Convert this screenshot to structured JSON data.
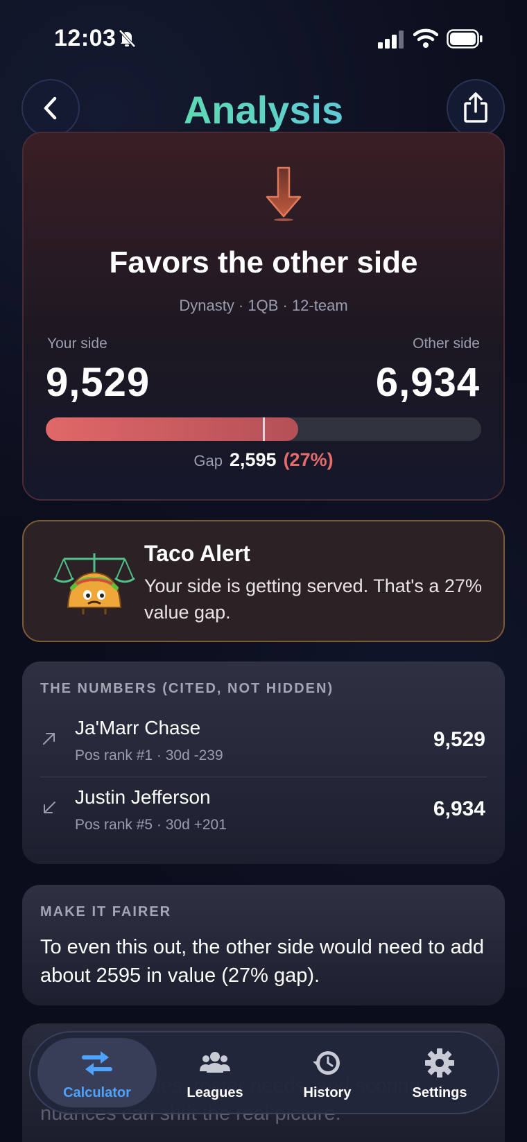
{
  "status_bar": {
    "time": "12:03"
  },
  "header": {
    "title": "Analysis"
  },
  "verdict": {
    "title": "Favors the other side",
    "subtitle": "Dynasty · 1QB · 12-team",
    "your_side_label": "Your side",
    "your_side_value": "9,529",
    "other_side_label": "Other side",
    "other_side_value": "6,934",
    "bar_fill_fraction": 0.58,
    "gap_label": "Gap",
    "gap_value": "2,595",
    "gap_percent": "(27%)"
  },
  "alert": {
    "title": "Taco Alert",
    "text": "Your side is getting served. That's a 27% value gap."
  },
  "numbers": {
    "heading": "THE NUMBERS (CITED, NOT HIDDEN)",
    "players": [
      {
        "name": "Ja'Marr Chase",
        "meta": "Pos rank #1 · 30d -239",
        "value": "9,529",
        "trend": "arrow-up-right"
      },
      {
        "name": "Justin Jefferson",
        "meta": "Pos rank #5 · 30d +201",
        "value": "6,934",
        "trend": "arrow-down-left"
      }
    ]
  },
  "fairer": {
    "heading": "MAKE IT FAIRER",
    "text": "To even this out, the other side would need to add about 2595 in value (27% gap)."
  },
  "hidden_note": {
    "text": "—league trades, roster needs, and scoring nuances can shift the real picture."
  },
  "tabbar": {
    "tabs": [
      {
        "label": "Calculator",
        "icon": "swap-arrows-icon",
        "active": true
      },
      {
        "label": "Leagues",
        "icon": "people-icon",
        "active": false
      },
      {
        "label": "History",
        "icon": "history-clock-icon",
        "active": false
      },
      {
        "label": "Settings",
        "icon": "gear-icon",
        "active": false
      }
    ]
  },
  "colors": {
    "accent": "#4ea3ff",
    "negative": "#e46c6c",
    "title_gradient": [
      "#5ee08a",
      "#66a8ff"
    ]
  }
}
